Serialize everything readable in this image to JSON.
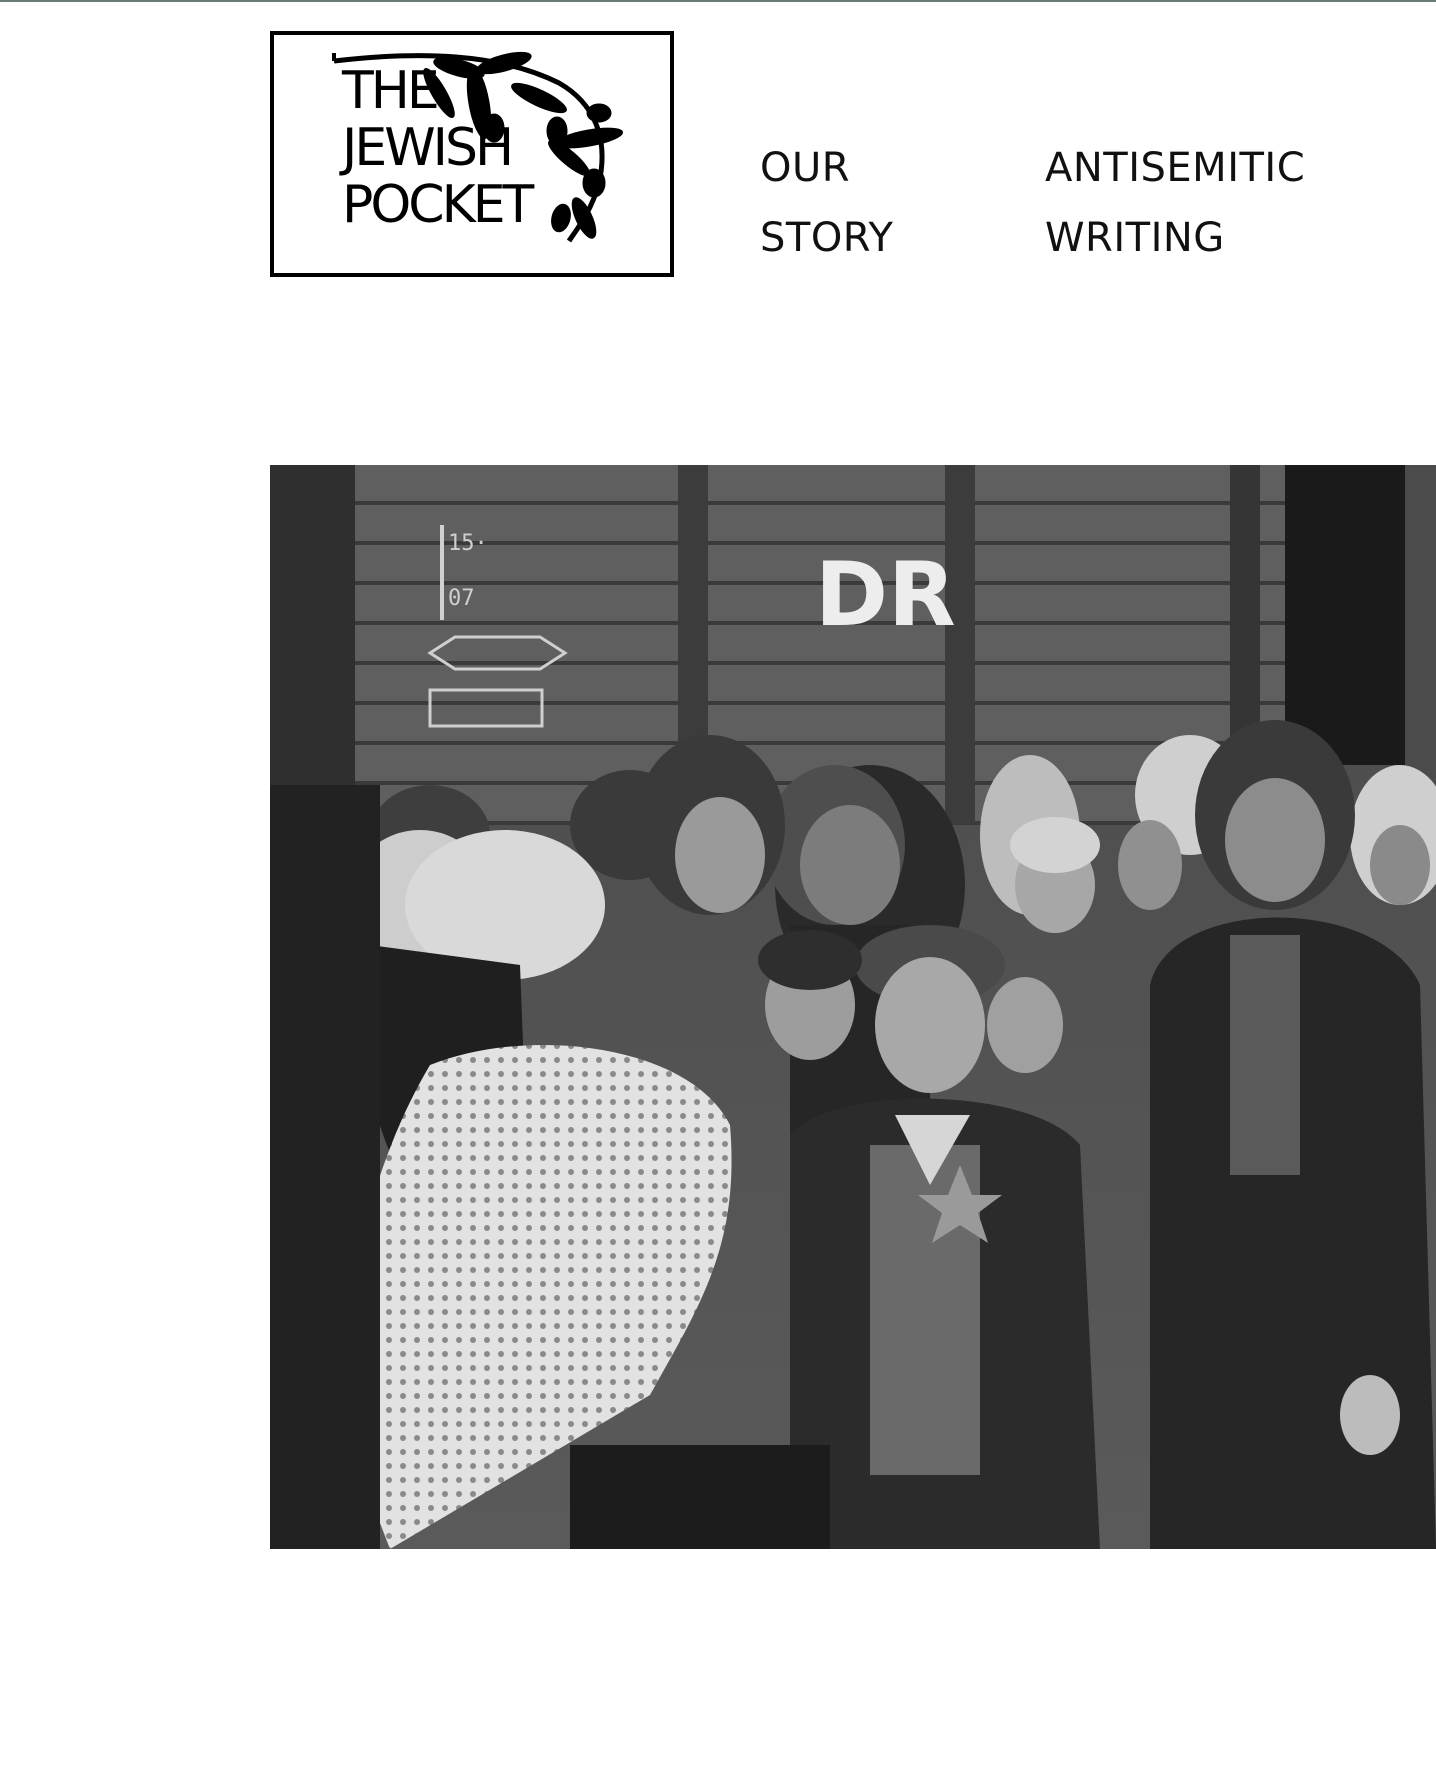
{
  "header": {
    "logo": {
      "lines": [
        "THE",
        "JEWISH",
        "POCKET"
      ],
      "icon": "olive-branch-icon"
    },
    "nav": [
      {
        "line1": "OUR",
        "line2": "STORY"
      },
      {
        "line1": "ANTISEMITIC",
        "line2": "WRITING"
      }
    ]
  },
  "hero": {
    "image": "historical-photo",
    "train_marking": "DR",
    "colors": {
      "dark": "#2b2b2b",
      "mid": "#6e6e6e",
      "light": "#d8d8d8"
    }
  }
}
